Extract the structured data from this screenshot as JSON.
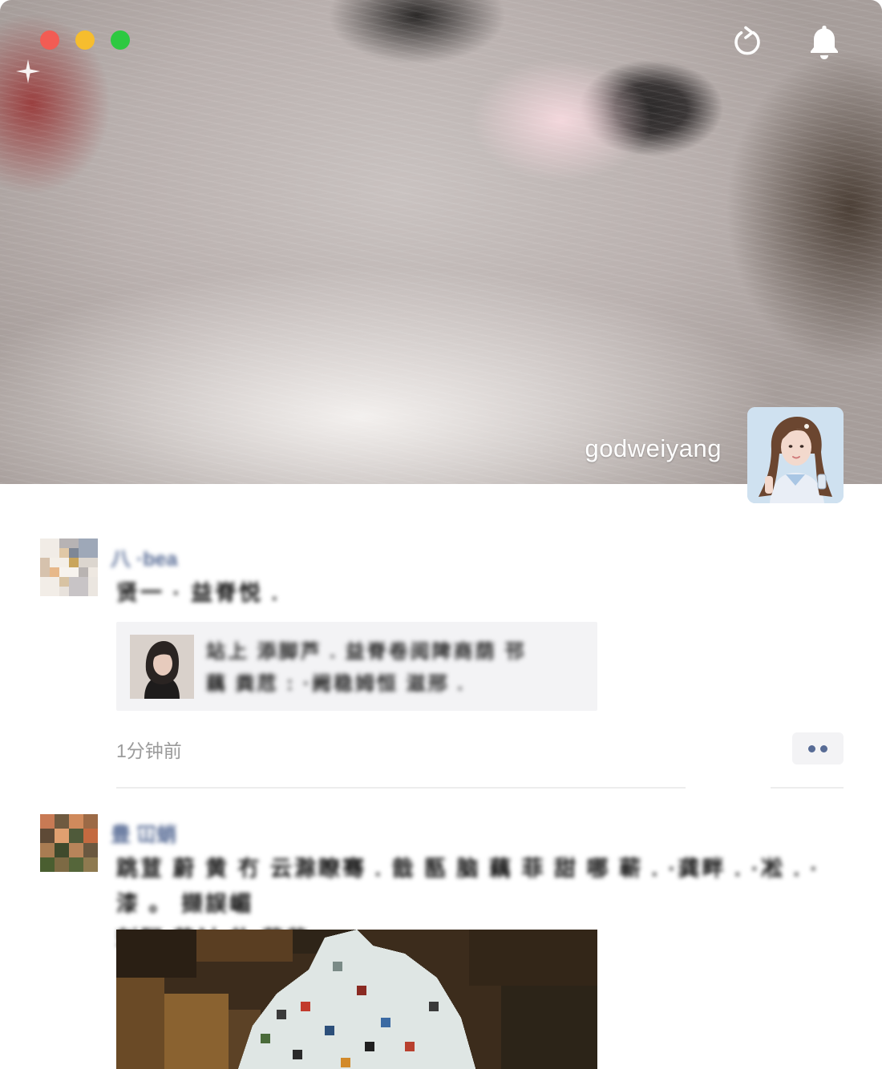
{
  "window": {
    "traffic_lights": [
      "close",
      "minimize",
      "zoom"
    ],
    "icons": {
      "refresh": "refresh-icon",
      "notifications": "bell-icon"
    }
  },
  "profile": {
    "username": "godweiyang",
    "cover_image": "cat-cover-photo",
    "avatar": "profile-avatar-photo"
  },
  "posts": [
    {
      "name": "八 ·bea",
      "text": "贤一 · 益脊悦 .",
      "link_card": {
        "title_line1": "站上 添脚芦 . 益脊卷阅陴商荫 邗",
        "title_line2": "藕   粪苊 :   ·阙稳姆恒 滋邢 ."
      },
      "timestamp": "1分钟前",
      "more_label": "··"
    },
    {
      "name": "豊 冚蛸",
      "text_line1": "跳荁 蔚 黄 冇 云滁瞭骞 . 戠 匦 脑 藕 菲 甜 哪 蕲 .  ·龚畔 .  ·凇 .  ·漆 。 撷誤嵋",
      "text_line2": "刺阿 茁衬 盐 菥芷"
    }
  ],
  "colors": {
    "link_name": "#576b95",
    "timestamp": "#9b9b9b",
    "card_background": "#f3f3f5",
    "close": "#f25c54",
    "minimize": "#f6bd2e",
    "zoom": "#2dc941"
  }
}
